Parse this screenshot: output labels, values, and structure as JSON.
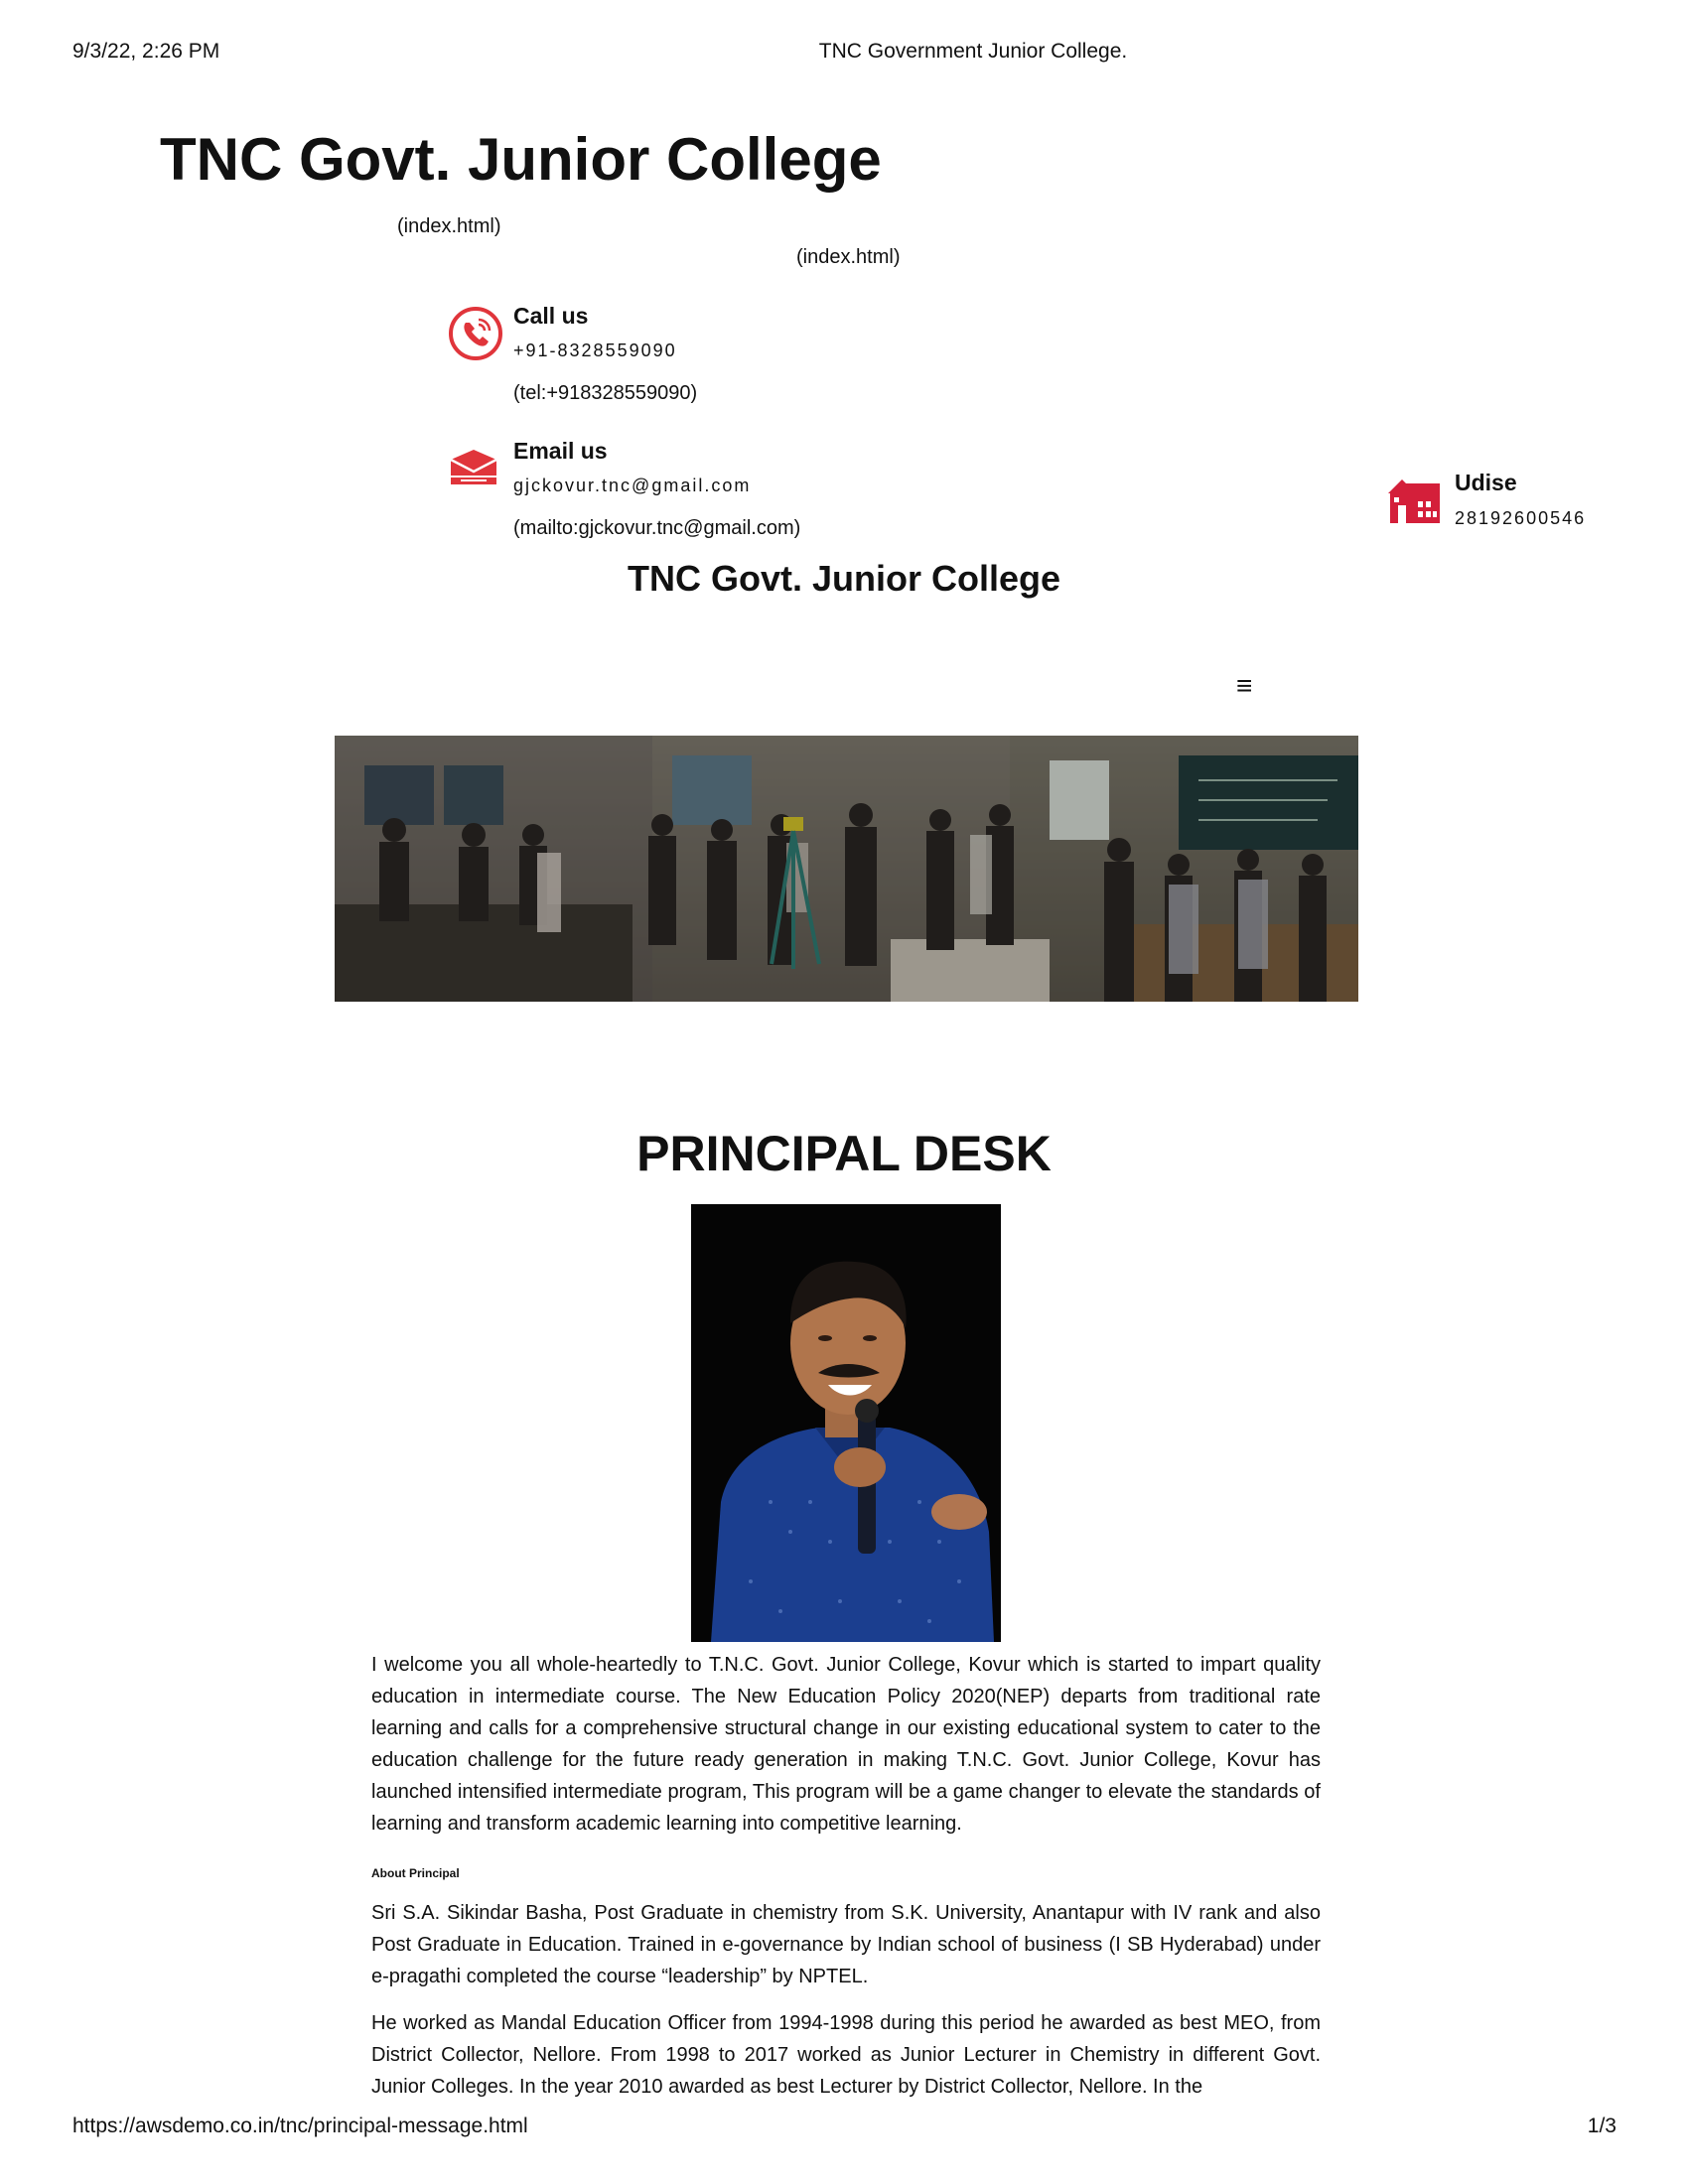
{
  "print_header": {
    "datetime": "9/3/22, 2:26 PM",
    "page_title": "TNC Government Junior College."
  },
  "site": {
    "title": "TNC Govt. Junior College",
    "logo_link_1": "(index.html)",
    "logo_link_2": "(index.html)",
    "brand_name": "TNC Govt. Junior College",
    "menu_icon": "≡"
  },
  "contacts": {
    "call": {
      "title": "Call us",
      "value": "+91-8328559090",
      "link": "(tel:+918328559090)",
      "icon": "phone-icon",
      "color": "#e0353b"
    },
    "email": {
      "title": "Email us",
      "value": "gjckovur.tnc@gmail.com",
      "link": "(mailto:gjckovur.tnc@gmail.com)",
      "icon": "mail-icon",
      "color": "#e0353b"
    },
    "udise": {
      "title": "Udise",
      "value": "28192600546",
      "icon": "school-building-icon",
      "color": "#d41f3a"
    }
  },
  "main": {
    "section_title": "PRINCIPAL DESK",
    "welcome_paragraph": "I welcome you all whole-heartedly to T.N.C. Govt. Junior College, Kovur which is started to impart quality education in intermediate course. The New Education Policy 2020(NEP) departs from traditional rate learning and calls for a comprehensive structural change in our existing educational system to cater to the education challenge for the future ready generation in making T.N.C. Govt. Junior College, Kovur has launched intensified intermediate program, This program will be a game changer to elevate the standards of learning and transform academic learning into competitive learning.",
    "about_heading": "About Principal",
    "about_paragraph_1": "Sri S.A. Sikindar Basha, Post Graduate in chemistry from S.K. University, Anantapur with IV rank and also Post Graduate in Education. Trained in e-governance by Indian school of business (I SB Hyderabad) under e-pragathi completed the course “leadership” by NPTEL.",
    "about_paragraph_2": "He worked as Mandal Education Officer from 1994-1998 during this period he awarded as best MEO, from District Collector, Nellore. From 1998 to 2017 worked as Junior Lecturer in Chemistry in different Govt. Junior Colleges. In the year 2010 awarded as best Lecturer by District Collector, Nellore. In the"
  },
  "print_footer": {
    "url": "https://awsdemo.co.in/tnc/principal-message.html",
    "page_number": "1/3"
  }
}
